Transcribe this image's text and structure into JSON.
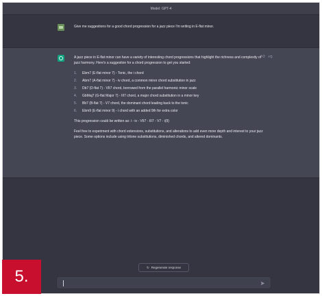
{
  "model_bar": {
    "label": "Model: GPT-4"
  },
  "user_message": {
    "text": "Give me suggestions for a good chord progression for a jazz piece I'm writing in E-flat minor."
  },
  "assistant_message": {
    "intro": "A jazz piece in E-flat minor can have a variety of interesting chord progressions that highlight the richness and complexity of jazz harmony. Here's a suggestion for a chord progression to get you started:",
    "items": [
      {
        "num": "1.",
        "text": "Ebm7 (E-flat minor 7) - Tonic, the i chord"
      },
      {
        "num": "2.",
        "text": "Abm7 (A-flat minor 7) - iv chord, a common minor chord substitution in jazz"
      },
      {
        "num": "3.",
        "text": "Db7 (D-flat 7) - VII7 chord, borrowed from the parallel harmonic minor scale"
      },
      {
        "num": "4.",
        "text": "GbMaj7 (G-flat Major 7) - III7 chord, a major chord substitution in a minor key"
      },
      {
        "num": "5.",
        "text": "Bb7 (B-flat 7) - V7 chord, the dominant chord leading back to the tonic"
      },
      {
        "num": "6.",
        "text": "Ebm9 (E-flat minor 9) - i chord with an added 9th for extra color"
      }
    ],
    "summary": "This progression could be written as: i - iv - VII7 - III7 - V7 - i(9)",
    "closing": "Feel free to experiment with chord extensions, substitutions, and alterations to add even more depth and interest to your jazz piece. Some options include using tritone substitutions, diminished chords, and altered dominants."
  },
  "actions": {
    "regenerate_icon": "refresh-icon",
    "regenerate_label": "Regenerate response",
    "thumbs_up_icon": "thumbs-up-icon",
    "thumbs_down_icon": "thumbs-down-icon",
    "send_icon": "send-icon"
  },
  "badge": {
    "label": "5."
  },
  "colors": {
    "background": "#343541",
    "assistant_row": "#444654",
    "badge": "#c8102e",
    "avatar_bot": "#10a37f"
  }
}
